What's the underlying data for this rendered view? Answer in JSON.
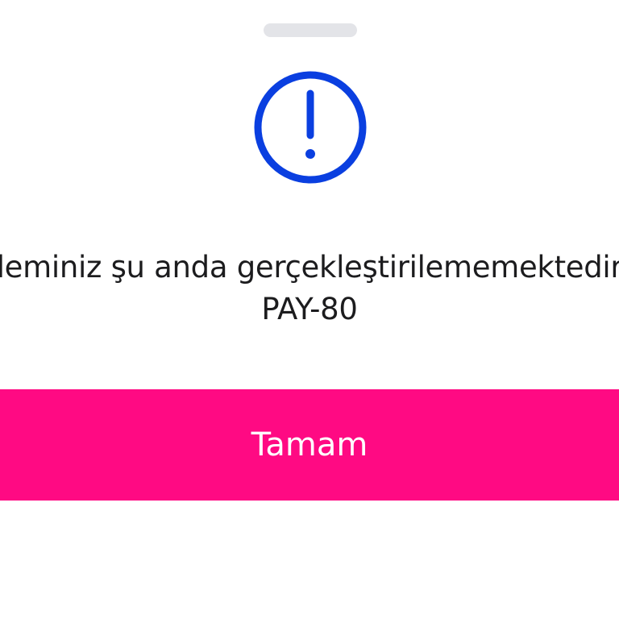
{
  "dialog": {
    "message_line1": "leminiz şu anda gerçekleştirilememektedir",
    "error_code": "PAY-80",
    "icon": "exclamation-circle-icon",
    "confirm_label": "Tamam"
  },
  "colors": {
    "accent": "#ff0a83",
    "icon": "#0a3fe0",
    "text": "#1c1c1e",
    "grabber": "#e3e4e8"
  }
}
